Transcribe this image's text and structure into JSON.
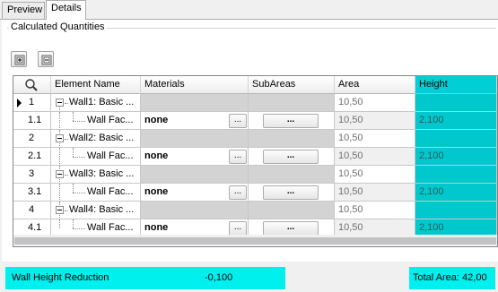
{
  "tabs": [
    {
      "label": "Preview",
      "active": false
    },
    {
      "label": "Details",
      "active": true
    }
  ],
  "section_title": "Calculated Quantities",
  "toolbar": {
    "expand_icon": "expand-all-icon",
    "collapse_icon": "collapse-all-icon"
  },
  "grid": {
    "columns": [
      "",
      "Element Name",
      "Materials",
      "SubAreas",
      "Area",
      "Height"
    ],
    "highlight_color": "#00d0d6",
    "rows": [
      {
        "num": "1",
        "name": "Wall1: Basic ...",
        "area": "10,50",
        "height": "",
        "type": "parent",
        "current": true
      },
      {
        "num": "1.1",
        "name": "Wall Fac...",
        "material": "none",
        "ellipsis": "...",
        "subareas": "...",
        "area": "10,50",
        "height": "2,100",
        "type": "child"
      },
      {
        "num": "2",
        "name": "Wall2: Basic ...",
        "area": "10,50",
        "height": "",
        "type": "parent"
      },
      {
        "num": "2.1",
        "name": "Wall Fac...",
        "material": "none",
        "ellipsis": "...",
        "subareas": "...",
        "area": "10,50",
        "height": "2,100",
        "type": "child"
      },
      {
        "num": "3",
        "name": "Wall3: Basic ...",
        "area": "10,50",
        "height": "",
        "type": "parent"
      },
      {
        "num": "3.1",
        "name": "Wall Fac...",
        "material": "none",
        "ellipsis": "...",
        "subareas": "...",
        "area": "10,50",
        "height": "2,100",
        "type": "child"
      },
      {
        "num": "4",
        "name": "Wall4: Basic ...",
        "area": "10,50",
        "height": "",
        "type": "parent"
      },
      {
        "num": "4.1",
        "name": "Wall Fac...",
        "material": "none",
        "ellipsis": "...",
        "subareas": "...",
        "area": "10,50",
        "height": "2,100",
        "type": "child"
      }
    ]
  },
  "status": {
    "wall_height_label": "Wall Height Reduction",
    "wall_height_value": "-0,100",
    "total_area": "Total Area: 42,00",
    "accent_color": "#00f0f0"
  }
}
